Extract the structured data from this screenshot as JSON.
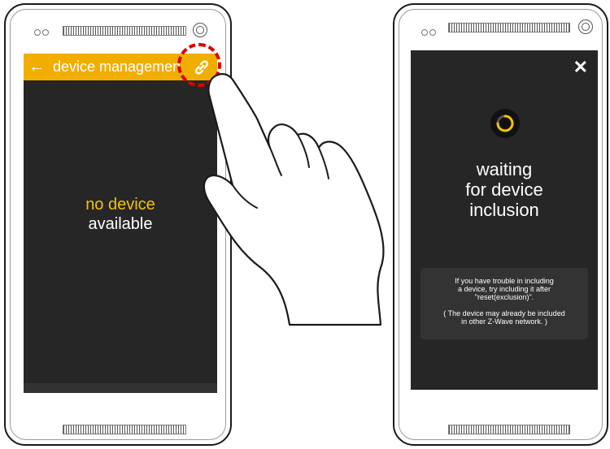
{
  "left_phone": {
    "appbar": {
      "back_icon": "arrow-left-icon",
      "title": "device managemen",
      "action_icon": "link-icon",
      "color": "#f2ae00"
    },
    "empty_state": {
      "line1": "no device",
      "line2": "available",
      "highlight_color": "#f5c300"
    }
  },
  "right_phone": {
    "close_icon": "close-icon",
    "spinner_icon": "loading-spinner-icon",
    "waiting": {
      "line1": "waiting",
      "line2": "for device",
      "line3": "inclusion"
    },
    "help": {
      "line1": "If you have trouble in including",
      "line2": "a device, try including it after",
      "line3": "\"reset(exclusion)\".",
      "line4": "( The device may already be included",
      "line5": "in other Z-Wave network. )"
    }
  },
  "colors": {
    "screen_bg": "#262626",
    "highlight_ring": "#e00000"
  }
}
